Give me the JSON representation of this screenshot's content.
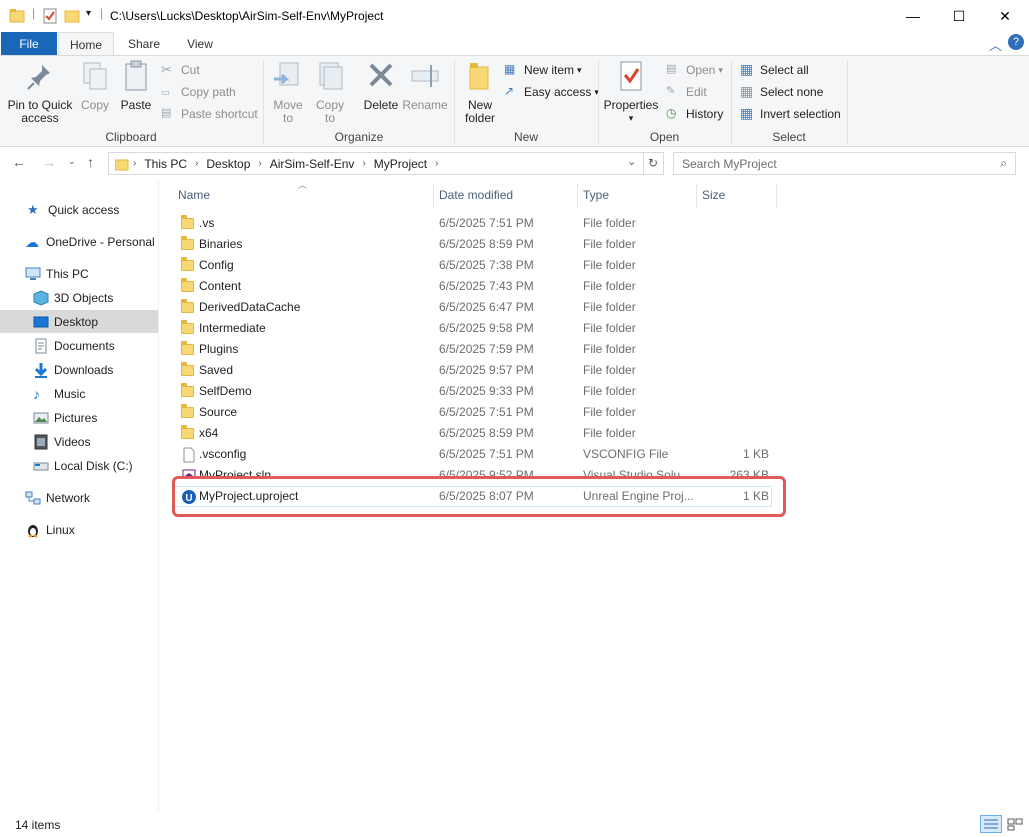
{
  "title": {
    "path": "C:\\Users\\Lucks\\Desktop\\AirSim-Self-Env\\MyProject",
    "minimize": "—",
    "maximize": "☐",
    "close": "✕"
  },
  "tabs": {
    "file": "File",
    "home": "Home",
    "share": "Share",
    "view": "View"
  },
  "ribbon": {
    "clipboard": {
      "label": "Clipboard",
      "pin": "Pin to Quick access",
      "copy": "Copy",
      "paste": "Paste",
      "cut": "Cut",
      "copy_path": "Copy path",
      "paste_shortcut": "Paste shortcut"
    },
    "organize": {
      "label": "Organize",
      "move_to": "Move to",
      "copy_to": "Copy to",
      "delete": "Delete",
      "rename": "Rename"
    },
    "new": {
      "label": "New",
      "new_folder": "New folder",
      "new_item": "New item",
      "easy_access": "Easy access"
    },
    "open": {
      "label": "Open",
      "properties": "Properties",
      "open": "Open",
      "edit": "Edit",
      "history": "History"
    },
    "select": {
      "label": "Select",
      "select_all": "Select all",
      "select_none": "Select none",
      "invert": "Invert selection"
    }
  },
  "address": {
    "crumbs": [
      "This PC",
      "Desktop",
      "AirSim-Self-Env",
      "MyProject"
    ],
    "search_placeholder": "Search MyProject"
  },
  "sidebar": {
    "items": [
      {
        "label": "Quick access",
        "icon": "star-icon"
      },
      {
        "label": "OneDrive - Personal",
        "icon": "cloud-icon"
      },
      {
        "label": "This PC",
        "icon": "computer-icon"
      },
      {
        "label": "3D Objects",
        "icon": "cube-icon"
      },
      {
        "label": "Desktop",
        "icon": "desktop-icon"
      },
      {
        "label": "Documents",
        "icon": "document-icon"
      },
      {
        "label": "Downloads",
        "icon": "download-icon"
      },
      {
        "label": "Music",
        "icon": "music-icon"
      },
      {
        "label": "Pictures",
        "icon": "picture-icon"
      },
      {
        "label": "Videos",
        "icon": "video-icon"
      },
      {
        "label": "Local Disk (C:)",
        "icon": "disk-icon"
      },
      {
        "label": "Network",
        "icon": "network-icon"
      },
      {
        "label": "Linux",
        "icon": "linux-icon"
      }
    ]
  },
  "columns": {
    "name": "Name",
    "date": "Date modified",
    "type": "Type",
    "size": "Size"
  },
  "files": [
    {
      "name": ".vs",
      "date": "6/5/2025 7:51 PM",
      "type": "File folder",
      "size": ""
    },
    {
      "name": "Binaries",
      "date": "6/5/2025 8:59 PM",
      "type": "File folder",
      "size": ""
    },
    {
      "name": "Config",
      "date": "6/5/2025 7:38 PM",
      "type": "File folder",
      "size": ""
    },
    {
      "name": "Content",
      "date": "6/5/2025 7:43 PM",
      "type": "File folder",
      "size": ""
    },
    {
      "name": "DerivedDataCache",
      "date": "6/5/2025 6:47 PM",
      "type": "File folder",
      "size": ""
    },
    {
      "name": "Intermediate",
      "date": "6/5/2025 9:58 PM",
      "type": "File folder",
      "size": ""
    },
    {
      "name": "Plugins",
      "date": "6/5/2025 7:59 PM",
      "type": "File folder",
      "size": ""
    },
    {
      "name": "Saved",
      "date": "6/5/2025 9:57 PM",
      "type": "File folder",
      "size": ""
    },
    {
      "name": "SelfDemo",
      "date": "6/5/2025 9:33 PM",
      "type": "File folder",
      "size": ""
    },
    {
      "name": "Source",
      "date": "6/5/2025 7:51 PM",
      "type": "File folder",
      "size": ""
    },
    {
      "name": "x64",
      "date": "6/5/2025 8:59 PM",
      "type": "File folder",
      "size": ""
    },
    {
      "name": ".vsconfig",
      "date": "6/5/2025 7:51 PM",
      "type": "VSCONFIG File",
      "size": "1 KB"
    },
    {
      "name": "MyProject.sln",
      "date": "6/5/2025 9:52 PM",
      "type": "Visual Studio Solu...",
      "size": "263 KB"
    },
    {
      "name": "MyProject.uproject",
      "date": "6/5/2025 8:07 PM",
      "type": "Unreal Engine Proj...",
      "size": "1 KB"
    }
  ],
  "status": {
    "count": "14 items"
  },
  "colors": {
    "accent": "#1a66b8",
    "highlight_box": "#e05a5a",
    "folder": "#f8d775"
  }
}
